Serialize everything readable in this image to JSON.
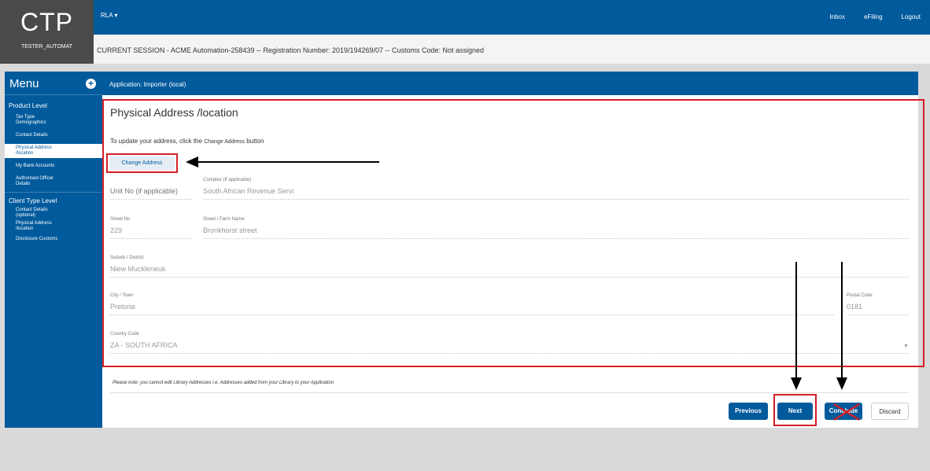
{
  "app": {
    "logo": "CTP",
    "user": "TESTER_AUTOMAT"
  },
  "topbar": {
    "rla": "RLA ▾",
    "nav": [
      "Inbox",
      "eFiling",
      "Logout"
    ]
  },
  "session": "CURRENT SESSION - ACME Automation-258439 -- Registration Number: 2019/194269/07 -- Customs Code: Not assigned",
  "menu": {
    "title": "Menu",
    "product_level": "Product Level",
    "product_items": [
      "Tax Type Demographics",
      "Contact Details",
      "Physical Address /location",
      "My Bank Accounts",
      "Authorised Officer Details"
    ],
    "client_level": "Client Type Level",
    "client_items": [
      "Contact Details (optional)",
      "Physical Address /location",
      "Disclosure Customs"
    ]
  },
  "application": "Application: Importer (local)",
  "page": {
    "title": "Physical Address /location",
    "hint_prefix": "To update your address, click the",
    "hint_button": "Change Address",
    "hint_suffix": "button",
    "change_button": "Change Address"
  },
  "fields": {
    "unit_no": "Unit No (if applicable)",
    "complex_label": "Complex (If applicable)",
    "complex_value": "South African Revenue Servi",
    "street_no_label": "Street No",
    "street_no_value": "229",
    "street_name_label": "Street / Farm Name",
    "street_name_value": "Bronkhorst street",
    "suburb_label": "Suburb / District",
    "suburb_value": "Niew Muckleneuk",
    "city_label": "City / Town",
    "city_value": "Pretoria",
    "postal_label": "Postal Code",
    "postal_value": "0181",
    "country_label": "Country Code",
    "country_value": "ZA - SOUTH AFRICA"
  },
  "note": "Please note: you cannot edit Library Addresses i.e. Addresses added from your Library to your Application",
  "buttons": {
    "previous": "Previous",
    "next": "Next",
    "conclude": "Conclude",
    "discard": "Discard"
  },
  "colors": {
    "primary": "#005a9c",
    "annotation_red": "#d41f26"
  }
}
